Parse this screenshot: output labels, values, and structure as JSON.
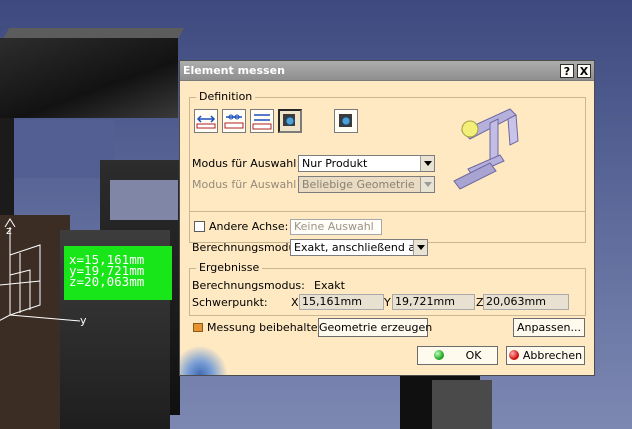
{
  "viewport": {
    "measurement": {
      "x": "x=15,161mm",
      "y": "y=19,721mm",
      "z": "z=20,063mm"
    },
    "axis_z": "z",
    "axis_y": "y",
    "colors": {
      "label_bg": "#19e619",
      "background_top": "#3e4a7f"
    }
  },
  "dialog": {
    "title": "Element messen",
    "help_button": "?",
    "close_button": "X",
    "definition": {
      "label": "Definition",
      "mode_buttons": [
        "measure-between-icon",
        "measure-item-icon",
        "measure-chain-icon",
        "measure-inertia-icon",
        "customize-measure-icon"
      ],
      "selection1_label": "Modus für Auswahl 1:",
      "selection1_value": "Nur Produkt",
      "selection2_label": "Modus für Auswahl 2:",
      "selection2_value": "Beliebige Geometrie",
      "other_axis_label": "Andere Achse:",
      "other_axis_value": "Keine Auswahl",
      "calc_mode_label": "Berechnungsmodus:",
      "calc_mode_value": "Exakt, anschließend ang"
    },
    "results": {
      "label": "Ergebnisse",
      "calc_mode_label": "Berechnungsmodus:",
      "calc_mode_value": "Exakt",
      "center_label": "Schwerpunkt:",
      "x_label": "X",
      "x_value": "15,161mm",
      "y_label": "Y",
      "y_value": "19,721mm",
      "z_label": "Z",
      "z_value": "20,063mm"
    },
    "keep_measure_label": "Messung beibehalten",
    "create_geometry_button": "Geometrie erzeugen",
    "customize_button": "Anpassen...",
    "ok_button": "OK",
    "cancel_button": "Abbrechen",
    "colors": {
      "dialog_bg": "#ffe9c2",
      "title_bg": "#9a9a9a"
    }
  }
}
